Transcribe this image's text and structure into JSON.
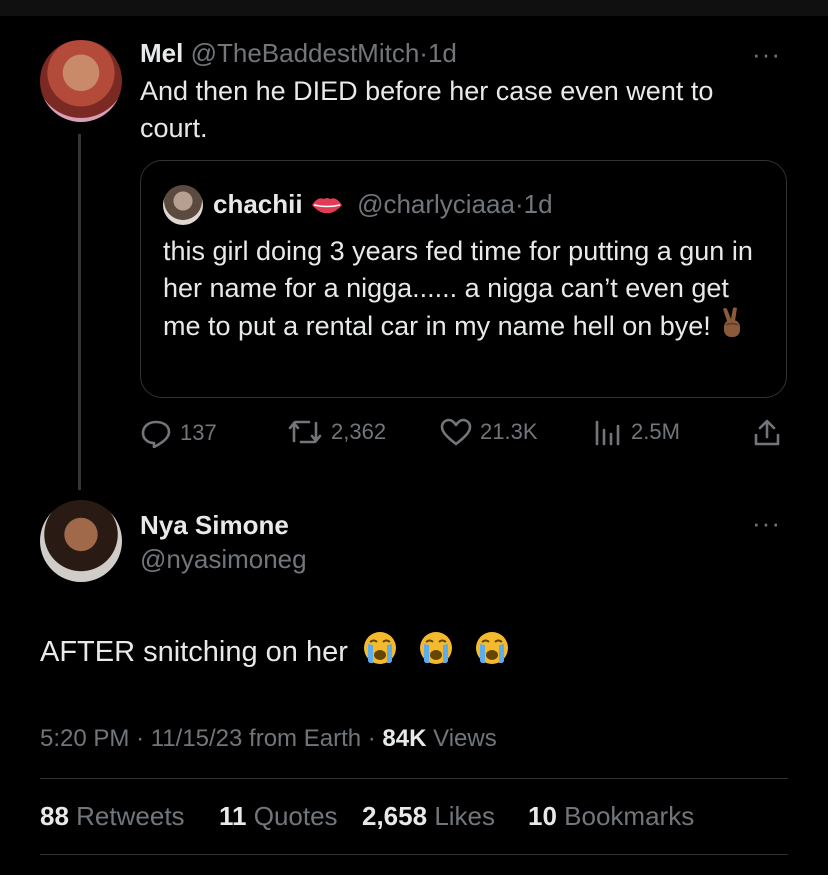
{
  "parent_tweet": {
    "name": "Mel",
    "handle": "@TheBaddestMitch",
    "separator": "·",
    "time": "1d",
    "text": "And then he DIED before her case even went to court.",
    "more_label": "···",
    "quote": {
      "name": "chachii",
      "name_emoji": "lips-icon",
      "handle": "@charlyciaaa",
      "separator": "·",
      "time": "1d",
      "text": "this girl doing 3 years fed time for putting a gun in her name for a nigga...... a nigga can’t even get me to put a rental car in my name hell on bye!",
      "trailing_emoji": "victory-hand-icon"
    },
    "actions": {
      "replies": "137",
      "retweets": "2,362",
      "likes": "21.3K",
      "views": "2.5M"
    }
  },
  "main_tweet": {
    "name": "Nya Simone",
    "handle": "@nyasimoneg",
    "more_label": "···",
    "text": "AFTER snitching on her",
    "emojis": [
      "loudly-crying-face-icon",
      "loudly-crying-face-icon",
      "loudly-crying-face-icon"
    ],
    "meta": {
      "time": "5:20 PM",
      "sep1": "·",
      "date": "11/15/23",
      "location": "from Earth",
      "sep2": "·",
      "views_count": "84K",
      "views_label": "Views"
    },
    "stats": {
      "retweets_count": "88",
      "retweets_label": "Retweets",
      "quotes_count": "11",
      "quotes_label": "Quotes",
      "likes_count": "2,658",
      "likes_label": "Likes",
      "bookmarks_count": "10",
      "bookmarks_label": "Bookmarks"
    }
  },
  "colors": {
    "background": "#000000",
    "text": "#e7e9ea",
    "muted": "#71767b",
    "border": "#2f3336"
  }
}
